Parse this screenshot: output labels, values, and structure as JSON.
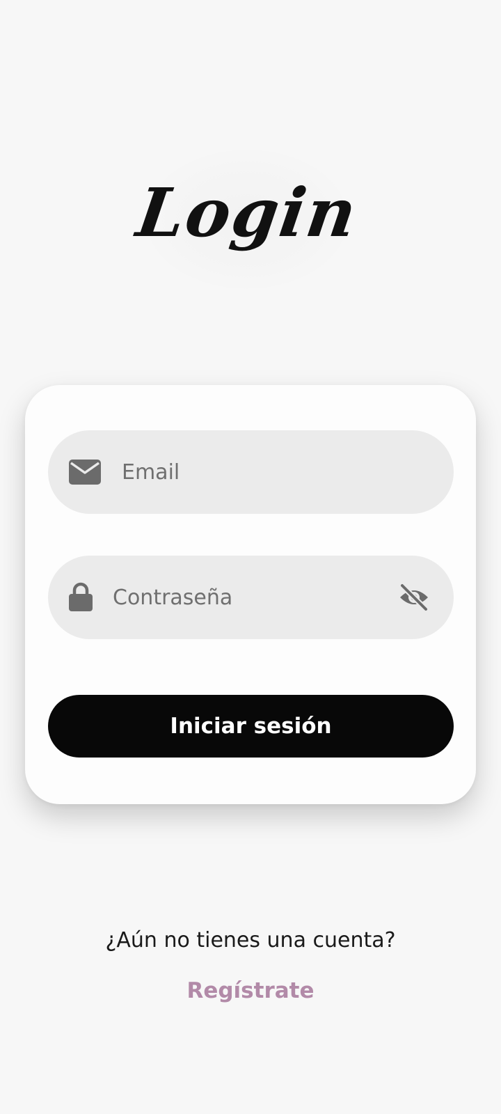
{
  "header": {
    "logo_text": "Login"
  },
  "form": {
    "email": {
      "placeholder": "Email",
      "value": "",
      "icon": "mail-icon"
    },
    "password": {
      "placeholder": "Contraseña",
      "value": "",
      "icon": "lock-icon",
      "toggle_icon": "eye-slash-icon"
    },
    "submit_label": "Iniciar sesión"
  },
  "footer": {
    "prompt": "¿Aún no tienes una cuenta?",
    "signup_label": "Regístrate"
  },
  "colors": {
    "background": "#f7f7f7",
    "card": "#fdfdfd",
    "field": "#ebebeb",
    "button": "#080808",
    "button_text": "#ffffff",
    "link": "#b28aa8",
    "icon": "#6b6b6b"
  }
}
